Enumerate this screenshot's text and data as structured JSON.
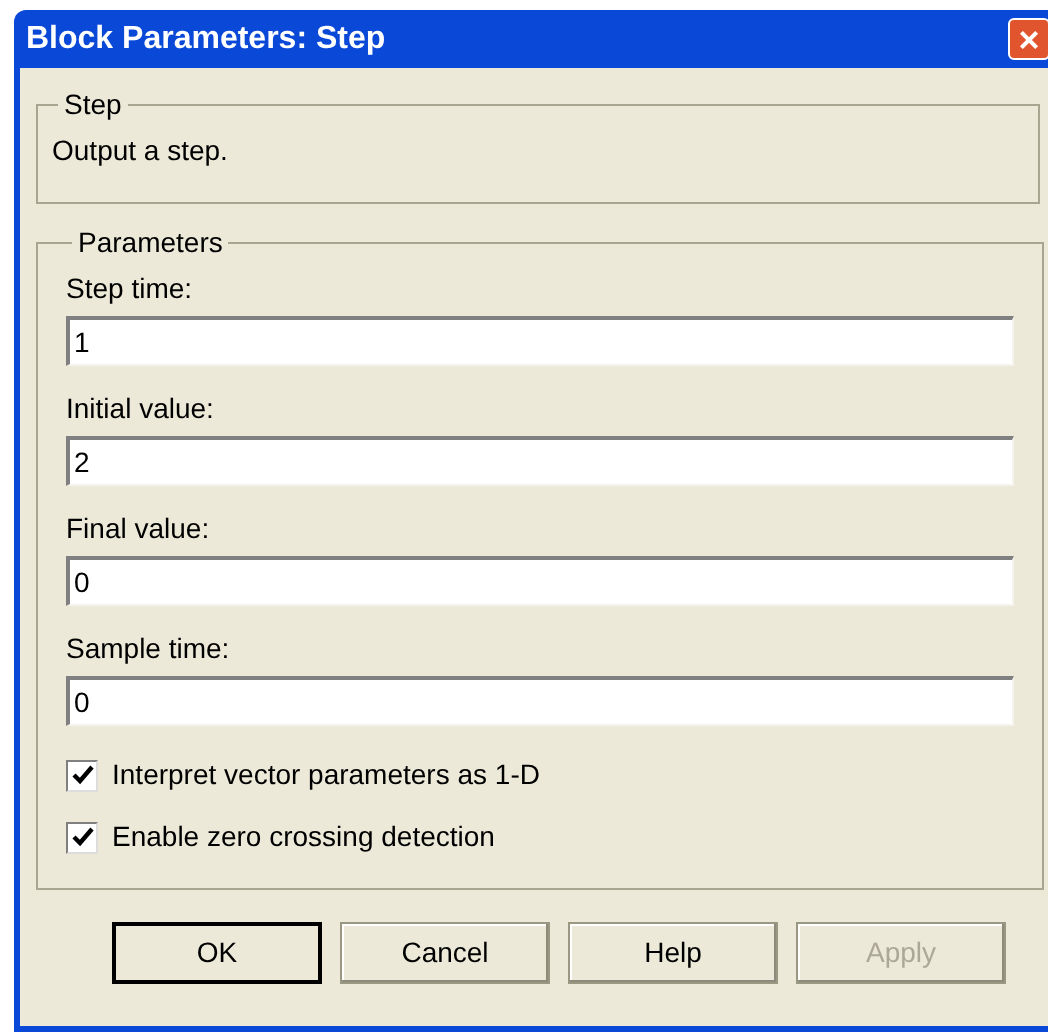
{
  "window": {
    "title": "Block Parameters: Step",
    "close": "×"
  },
  "description_group": {
    "title": "Step",
    "text": "Output a step."
  },
  "parameters_group": {
    "title": "Parameters",
    "fields": [
      {
        "label": "Step time:",
        "value": "1"
      },
      {
        "label": "Initial value:",
        "value": "2"
      },
      {
        "label": "Final value:",
        "value": "0"
      },
      {
        "label": "Sample time:",
        "value": "0"
      }
    ],
    "checkboxes": [
      {
        "label": "Interpret vector parameters as 1-D",
        "checked": true
      },
      {
        "label": "Enable zero crossing detection",
        "checked": true
      }
    ]
  },
  "buttons": [
    {
      "label": "OK",
      "default": true,
      "disabled": false
    },
    {
      "label": "Cancel",
      "default": false,
      "disabled": false
    },
    {
      "label": "Help",
      "default": false,
      "disabled": false
    },
    {
      "label": "Apply",
      "default": false,
      "disabled": true
    }
  ]
}
